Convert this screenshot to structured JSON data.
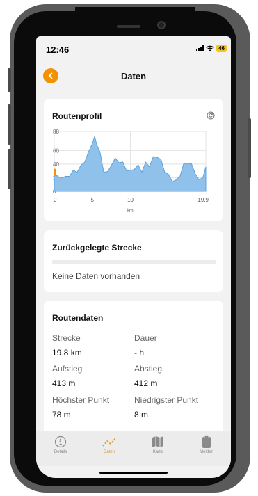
{
  "status": {
    "time": "12:46",
    "battery": "46"
  },
  "header": {
    "title": "Daten"
  },
  "profile": {
    "title": "Routenprofil",
    "x_unit": "km"
  },
  "chart_data": {
    "type": "area",
    "title": "Routenprofil",
    "xlabel": "km",
    "ylabel": "",
    "xlim": [
      0,
      19.9
    ],
    "ylim": [
      0,
      88
    ],
    "x_ticks": [
      "0",
      "5",
      "10",
      "19,9"
    ],
    "y_ticks": [
      "0",
      "20",
      "40",
      "60",
      "88"
    ],
    "grid": true,
    "colors": {
      "fill": "#8fc1ea",
      "line": "#5ba3dc",
      "start_marker": "#f39200"
    },
    "series": [
      {
        "x": [
          0,
          0.5,
          1,
          1.5,
          2,
          2.5,
          3,
          3.5,
          4,
          4.5,
          5,
          5.3,
          5.6,
          6,
          6.5,
          7,
          7.5,
          8,
          8.5,
          9,
          9.5,
          10,
          10.5,
          11,
          11.5,
          12,
          12.5,
          13,
          13.5,
          14,
          14.5,
          15,
          15.5,
          16,
          16.5,
          17,
          17.5,
          18,
          18.5,
          19,
          19.5,
          19.9
        ],
        "y": [
          28,
          18,
          22,
          19,
          24,
          28,
          30,
          35,
          45,
          55,
          72,
          78,
          70,
          55,
          30,
          26,
          40,
          46,
          44,
          40,
          32,
          28,
          34,
          36,
          30,
          40,
          38,
          48,
          52,
          44,
          30,
          22,
          16,
          14,
          24,
          38,
          42,
          38,
          28,
          14,
          22,
          36
        ]
      }
    ]
  },
  "traveled": {
    "title": "Zurückgelegte Strecke",
    "empty_text": "Keine Daten vorhanden"
  },
  "route_data": {
    "title": "Routendaten",
    "distance_label": "Strecke",
    "distance_value": "19.8 km",
    "duration_label": "Dauer",
    "duration_value": "- h",
    "ascent_label": "Aufstieg",
    "ascent_value": "413 m",
    "descent_label": "Abstieg",
    "descent_value": "412 m",
    "highest_label": "Höchster Punkt",
    "highest_value": "78 m",
    "lowest_label": "Niedrigster Punkt",
    "lowest_value": "8 m"
  },
  "tabs": [
    {
      "label": "Details",
      "icon": "info-icon"
    },
    {
      "label": "Daten",
      "icon": "chart-line-icon"
    },
    {
      "label": "Karte",
      "icon": "map-icon"
    },
    {
      "label": "Melden",
      "icon": "clipboard-icon"
    }
  ]
}
